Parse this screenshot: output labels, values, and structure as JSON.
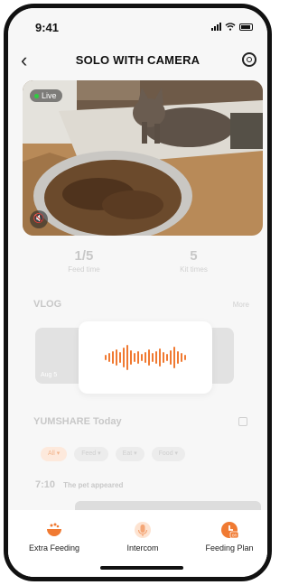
{
  "status_bar": {
    "time": "9:41"
  },
  "header": {
    "title": "SOLO WITH CAMERA"
  },
  "camera": {
    "live_label": "Live"
  },
  "stats": [
    {
      "value": "1/5",
      "label": "Feed time"
    },
    {
      "value": "5",
      "label": "Kit times"
    }
  ],
  "vlog": {
    "title": "VLOG",
    "more": "More",
    "cards": [
      {
        "date": "Aug 5"
      },
      {
        "date": ""
      },
      {
        "date": ""
      }
    ]
  },
  "today": {
    "title": "YUMSHARE Today",
    "chips": [
      "All ▾",
      "Feed ▾",
      "Eat ▾",
      "Food ▾"
    ],
    "event_time": "7:10",
    "event_text": "The pet appeared"
  },
  "tabs": [
    {
      "label": "Extra Feeding",
      "icon": "bowl-icon"
    },
    {
      "label": "Intercom",
      "icon": "microphone-icon"
    },
    {
      "label": "Feeding Plan",
      "icon": "clock-on-icon"
    }
  ],
  "colors": {
    "accent": "#f07a32",
    "live_dot": "#2ecc40"
  }
}
